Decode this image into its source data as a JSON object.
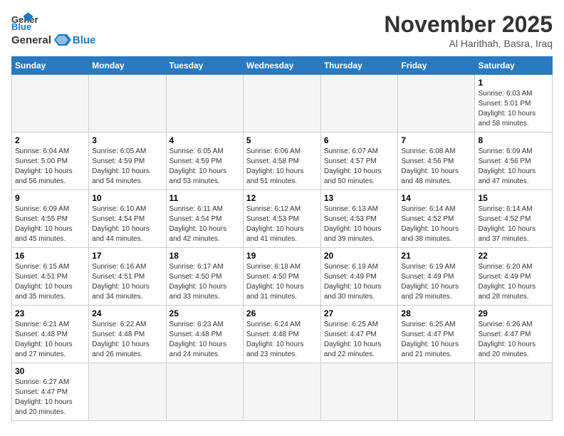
{
  "logo": {
    "line1": "General",
    "line2": "Blue"
  },
  "title": "November 2025",
  "location": "Al Harithah, Basra, Iraq",
  "weekdays": [
    "Sunday",
    "Monday",
    "Tuesday",
    "Wednesday",
    "Thursday",
    "Friday",
    "Saturday"
  ],
  "days": [
    {
      "num": "",
      "info": ""
    },
    {
      "num": "",
      "info": ""
    },
    {
      "num": "",
      "info": ""
    },
    {
      "num": "",
      "info": ""
    },
    {
      "num": "",
      "info": ""
    },
    {
      "num": "",
      "info": ""
    },
    {
      "num": "1",
      "info": "Sunrise: 6:03 AM\nSunset: 5:01 PM\nDaylight: 10 hours\nand 58 minutes."
    },
    {
      "num": "2",
      "info": "Sunrise: 6:04 AM\nSunset: 5:00 PM\nDaylight: 10 hours\nand 56 minutes."
    },
    {
      "num": "3",
      "info": "Sunrise: 6:05 AM\nSunset: 4:59 PM\nDaylight: 10 hours\nand 54 minutes."
    },
    {
      "num": "4",
      "info": "Sunrise: 6:05 AM\nSunset: 4:59 PM\nDaylight: 10 hours\nand 53 minutes."
    },
    {
      "num": "5",
      "info": "Sunrise: 6:06 AM\nSunset: 4:58 PM\nDaylight: 10 hours\nand 51 minutes."
    },
    {
      "num": "6",
      "info": "Sunrise: 6:07 AM\nSunset: 4:57 PM\nDaylight: 10 hours\nand 50 minutes."
    },
    {
      "num": "7",
      "info": "Sunrise: 6:08 AM\nSunset: 4:56 PM\nDaylight: 10 hours\nand 48 minutes."
    },
    {
      "num": "8",
      "info": "Sunrise: 6:09 AM\nSunset: 4:56 PM\nDaylight: 10 hours\nand 47 minutes."
    },
    {
      "num": "9",
      "info": "Sunrise: 6:09 AM\nSunset: 4:55 PM\nDaylight: 10 hours\nand 45 minutes."
    },
    {
      "num": "10",
      "info": "Sunrise: 6:10 AM\nSunset: 4:54 PM\nDaylight: 10 hours\nand 44 minutes."
    },
    {
      "num": "11",
      "info": "Sunrise: 6:11 AM\nSunset: 4:54 PM\nDaylight: 10 hours\nand 42 minutes."
    },
    {
      "num": "12",
      "info": "Sunrise: 6:12 AM\nSunset: 4:53 PM\nDaylight: 10 hours\nand 41 minutes."
    },
    {
      "num": "13",
      "info": "Sunrise: 6:13 AM\nSunset: 4:53 PM\nDaylight: 10 hours\nand 39 minutes."
    },
    {
      "num": "14",
      "info": "Sunrise: 6:14 AM\nSunset: 4:52 PM\nDaylight: 10 hours\nand 38 minutes."
    },
    {
      "num": "15",
      "info": "Sunrise: 6:14 AM\nSunset: 4:52 PM\nDaylight: 10 hours\nand 37 minutes."
    },
    {
      "num": "16",
      "info": "Sunrise: 6:15 AM\nSunset: 4:51 PM\nDaylight: 10 hours\nand 35 minutes."
    },
    {
      "num": "17",
      "info": "Sunrise: 6:16 AM\nSunset: 4:51 PM\nDaylight: 10 hours\nand 34 minutes."
    },
    {
      "num": "18",
      "info": "Sunrise: 6:17 AM\nSunset: 4:50 PM\nDaylight: 10 hours\nand 33 minutes."
    },
    {
      "num": "19",
      "info": "Sunrise: 6:18 AM\nSunset: 4:50 PM\nDaylight: 10 hours\nand 31 minutes."
    },
    {
      "num": "20",
      "info": "Sunrise: 6:19 AM\nSunset: 4:49 PM\nDaylight: 10 hours\nand 30 minutes."
    },
    {
      "num": "21",
      "info": "Sunrise: 6:19 AM\nSunset: 4:49 PM\nDaylight: 10 hours\nand 29 minutes."
    },
    {
      "num": "22",
      "info": "Sunrise: 6:20 AM\nSunset: 4:49 PM\nDaylight: 10 hours\nand 28 minutes."
    },
    {
      "num": "23",
      "info": "Sunrise: 6:21 AM\nSunset: 4:48 PM\nDaylight: 10 hours\nand 27 minutes."
    },
    {
      "num": "24",
      "info": "Sunrise: 6:22 AM\nSunset: 4:48 PM\nDaylight: 10 hours\nand 26 minutes."
    },
    {
      "num": "25",
      "info": "Sunrise: 6:23 AM\nSunset: 4:48 PM\nDaylight: 10 hours\nand 24 minutes."
    },
    {
      "num": "26",
      "info": "Sunrise: 6:24 AM\nSunset: 4:48 PM\nDaylight: 10 hours\nand 23 minutes."
    },
    {
      "num": "27",
      "info": "Sunrise: 6:25 AM\nSunset: 4:47 PM\nDaylight: 10 hours\nand 22 minutes."
    },
    {
      "num": "28",
      "info": "Sunrise: 6:25 AM\nSunset: 4:47 PM\nDaylight: 10 hours\nand 21 minutes."
    },
    {
      "num": "29",
      "info": "Sunrise: 6:26 AM\nSunset: 4:47 PM\nDaylight: 10 hours\nand 20 minutes."
    },
    {
      "num": "30",
      "info": "Sunrise: 6:27 AM\nSunset: 4:47 PM\nDaylight: 10 hours\nand 20 minutes."
    },
    {
      "num": "",
      "info": ""
    },
    {
      "num": "",
      "info": ""
    },
    {
      "num": "",
      "info": ""
    },
    {
      "num": "",
      "info": ""
    },
    {
      "num": "",
      "info": ""
    },
    {
      "num": "",
      "info": ""
    }
  ]
}
